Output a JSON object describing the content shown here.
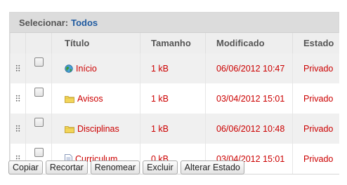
{
  "selection": {
    "label": "Selecionar:",
    "all_link": "Todos"
  },
  "columns": {
    "title": "Título",
    "size": "Tamanho",
    "modified": "Modificado",
    "state": "Estado"
  },
  "rows": [
    {
      "name": "Início",
      "icon": "globe-icon",
      "size": "1 kB",
      "modified": "06/06/2012 10:47",
      "state": "Privado"
    },
    {
      "name": "Avisos",
      "icon": "folder-icon",
      "size": "1 kB",
      "modified": "03/04/2012 15:01",
      "state": "Privado"
    },
    {
      "name": "Disciplinas",
      "icon": "folder-icon",
      "size": "1 kB",
      "modified": "06/06/2012 10:48",
      "state": "Privado"
    },
    {
      "name": "Curriculum",
      "icon": "document-icon",
      "size": "0 kB",
      "modified": "03/04/2012 15:01",
      "state": "Privado"
    }
  ],
  "buttons": {
    "copy": "Copiar",
    "cut": "Recortar",
    "rename": "Renomear",
    "delete": "Excluir",
    "change_state": "Alterar Estado"
  },
  "colors": {
    "link_red": "#cc0000",
    "link_blue": "#1f5aa0",
    "header_bg": "#dcdcdc"
  }
}
